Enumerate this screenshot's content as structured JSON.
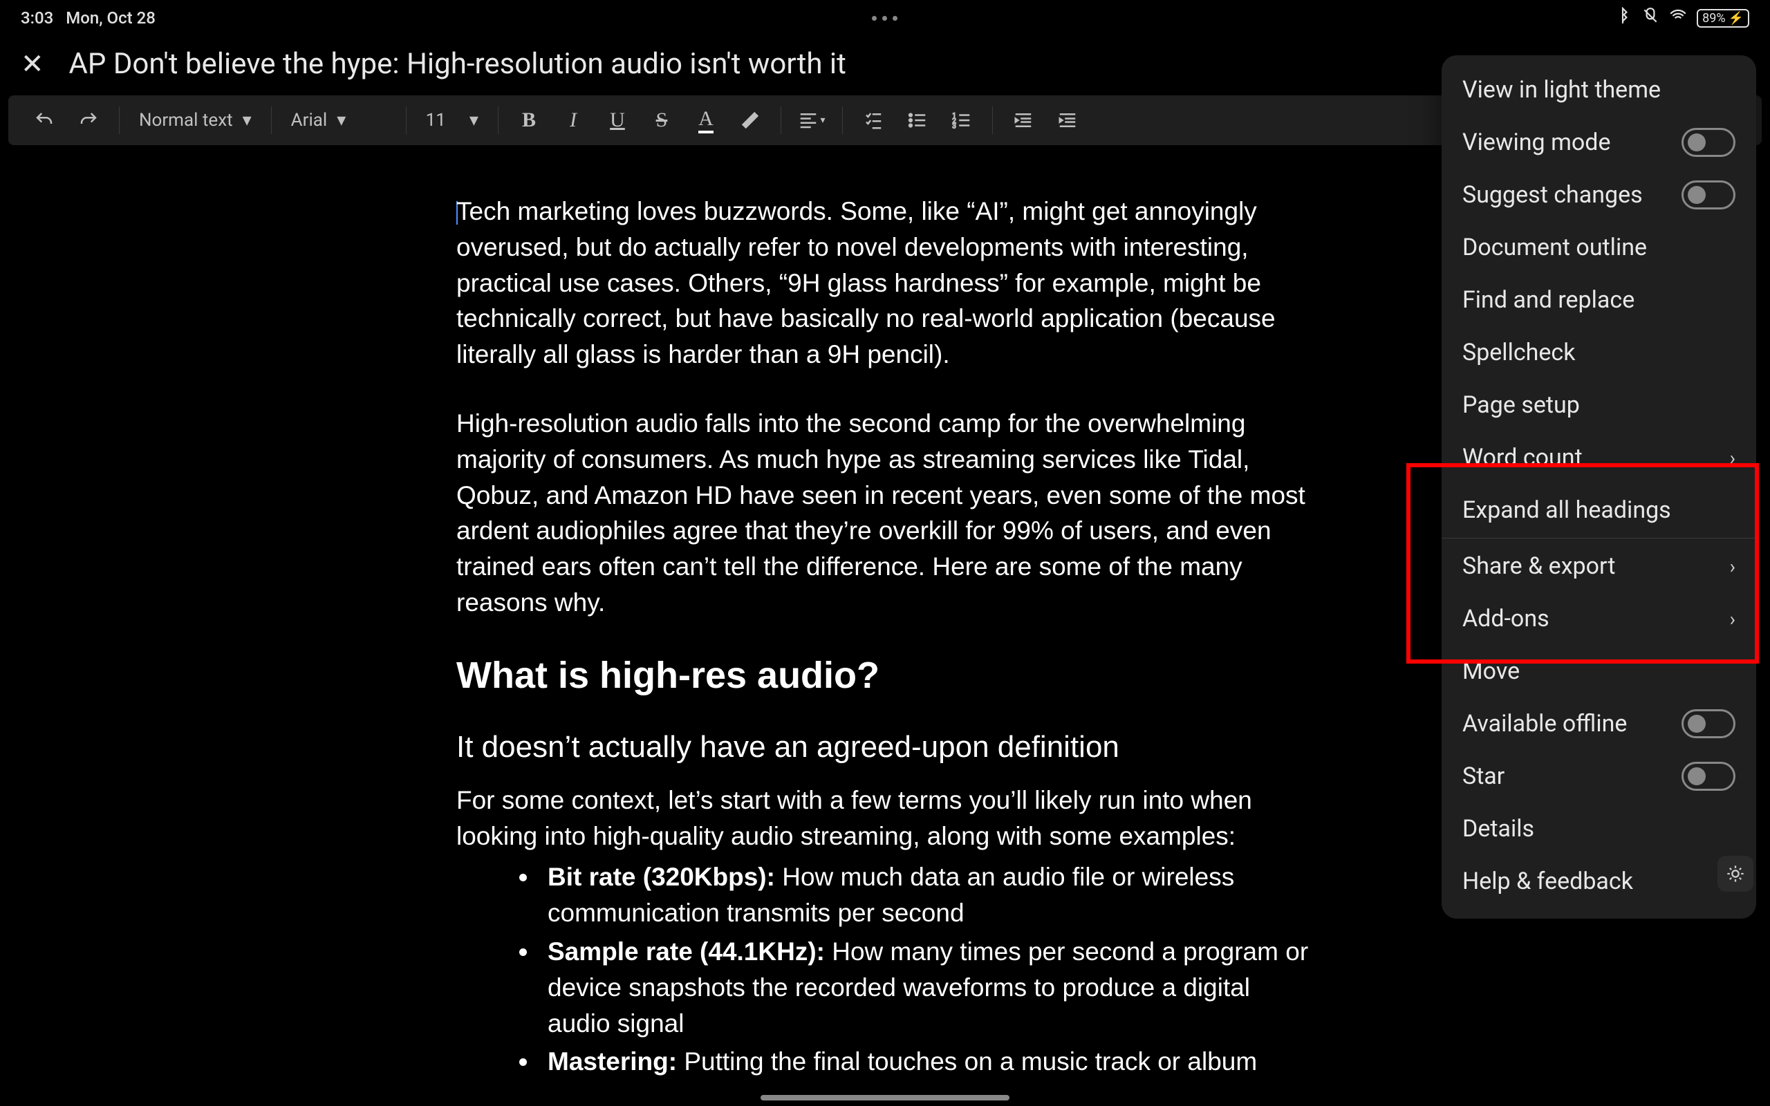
{
  "status": {
    "time": "3:03",
    "date": "Mon, Oct 28",
    "battery": "89%"
  },
  "document": {
    "title": "AP Don't believe the hype: High-resolution audio isn't worth it"
  },
  "toolbar": {
    "style_select": "Normal text",
    "font_select": "Arial",
    "size_select": "11"
  },
  "content": {
    "p1": "Tech marketing loves buzzwords. Some, like “AI”, might get annoyingly overused, but do actually refer to novel developments with interesting, practical use cases. Others, “9H glass hardness” for example, might be technically correct, but have basically no real-world application (because literally all glass is harder than a 9H pencil).",
    "p2": "High-resolution audio falls into the second camp for the overwhelming majority of consumers. As much hype as streaming services like Tidal, Qobuz, and Amazon HD have seen in recent years, even some of the most ardent audiophiles agree that they’re overkill for 99% of users, and even trained ears often can’t tell the difference. Here are some of the many reasons why.",
    "h2": "What is high-res audio?",
    "h3": "It doesn’t actually have an agreed-upon definition",
    "p3": "For some context, let’s start with a few terms you’ll likely run into when looking into high-quality audio streaming, along with some examples:",
    "li1_bold": "Bit rate (320Kbps):",
    "li1_rest": " How much data an audio file or wireless communication transmits per second",
    "li2_bold": "Sample rate (44.1KHz):",
    "li2_rest": " How many times per second a program or device snapshots the recorded waveforms to produce a digital audio signal",
    "li3_bold": "Mastering:",
    "li3_rest": " Putting the final touches on a music track or album"
  },
  "menu": {
    "view_light": "View in light theme",
    "viewing_mode": "Viewing mode",
    "suggest": "Suggest changes",
    "outline": "Document outline",
    "find_replace": "Find and replace",
    "spellcheck": "Spellcheck",
    "page_setup": "Page setup",
    "word_count": "Word count",
    "expand_headings": "Expand all headings",
    "share_export": "Share & export",
    "addons": "Add-ons",
    "move": "Move",
    "offline": "Available offline",
    "star": "Star",
    "details": "Details",
    "help": "Help & feedback"
  }
}
